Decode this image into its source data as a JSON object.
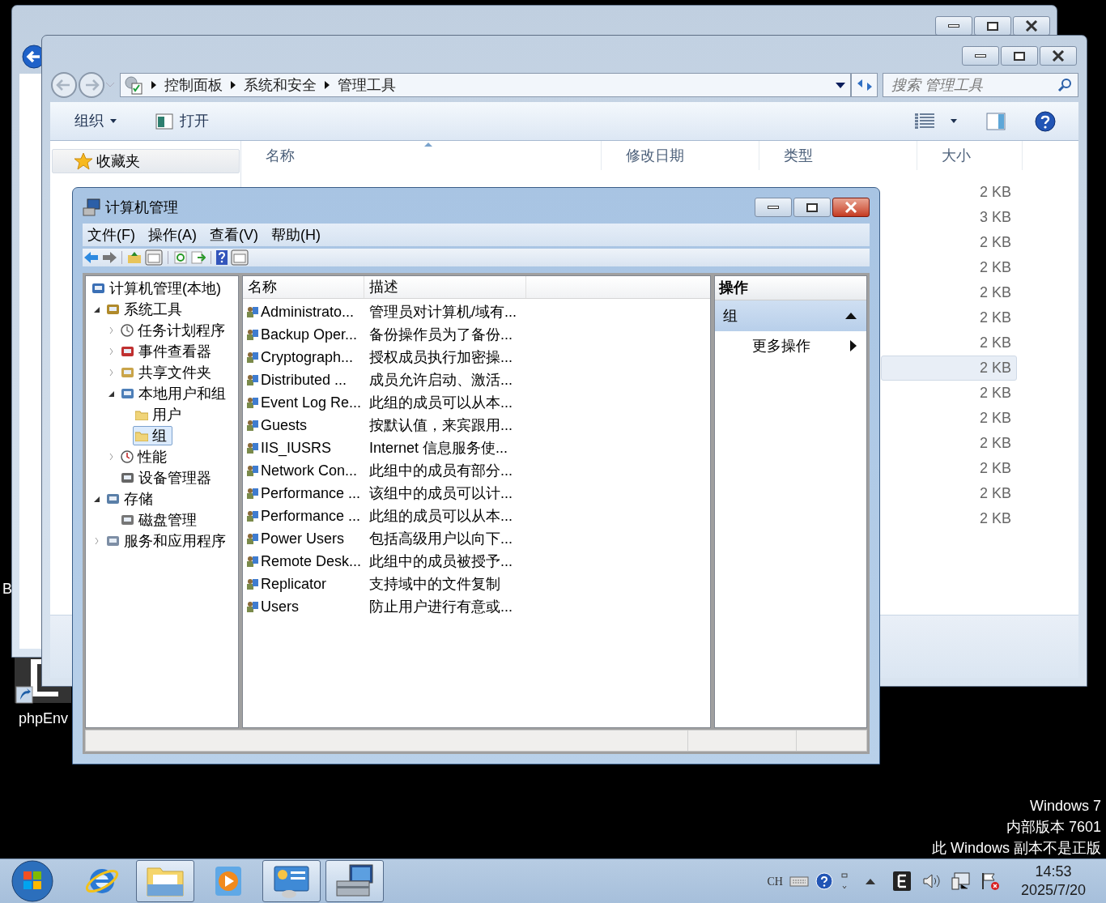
{
  "desktop": {
    "partial_label": "B",
    "icons": [
      {
        "label": "phpEnv"
      }
    ],
    "watermark": [
      "Windows 7",
      "内部版本 7601",
      "此 Windows 副本不是正版"
    ]
  },
  "explorer": {
    "breadcrumb": [
      "控制面板",
      "系统和安全",
      "管理工具"
    ],
    "search": {
      "placeholder": "搜索 管理工具"
    },
    "toolbar": [
      "组织",
      "打开"
    ],
    "nav": {
      "favorites": "收藏夹"
    },
    "columns": [
      "名称",
      "修改日期",
      "类型",
      "大小"
    ],
    "rows": [
      {
        "size": "2 KB",
        "selected": false
      },
      {
        "size": "3 KB",
        "selected": false
      },
      {
        "size": "2 KB",
        "selected": false
      },
      {
        "size": "2 KB",
        "selected": false
      },
      {
        "size": "2 KB",
        "selected": false
      },
      {
        "size": "2 KB",
        "selected": false
      },
      {
        "size": "2 KB",
        "selected": false
      },
      {
        "size": "2 KB",
        "selected": true
      },
      {
        "size": "2 KB",
        "selected": false
      },
      {
        "size": "2 KB",
        "selected": false
      },
      {
        "size": "2 KB",
        "selected": false
      },
      {
        "size": "2 KB",
        "selected": false
      },
      {
        "size": "2 KB",
        "selected": false
      },
      {
        "size": "2 KB",
        "selected": false
      }
    ]
  },
  "mmc": {
    "title": "计算机管理",
    "menu": [
      "文件(F)",
      "操作(A)",
      "查看(V)",
      "帮助(H)"
    ],
    "tree": [
      {
        "label": "计算机管理(本地)",
        "kind": "computer",
        "selected": false,
        "children": [
          {
            "label": "系统工具",
            "kind": "tools",
            "expanded": true,
            "selected": false,
            "children": [
              {
                "label": "任务计划程序",
                "kind": "clock",
                "expanded": false,
                "selected": false
              },
              {
                "label": "事件查看器",
                "kind": "event",
                "expanded": false,
                "selected": false
              },
              {
                "label": "共享文件夹",
                "kind": "share",
                "expanded": false,
                "selected": false
              },
              {
                "label": "本地用户和组",
                "kind": "users",
                "expanded": true,
                "selected": false,
                "children": [
                  {
                    "label": "用户",
                    "kind": "folder",
                    "selected": false
                  },
                  {
                    "label": "组",
                    "kind": "folder",
                    "selected": true
                  }
                ]
              },
              {
                "label": "性能",
                "kind": "perf",
                "expanded": false,
                "selected": false
              },
              {
                "label": "设备管理器",
                "kind": "device",
                "selected": false
              }
            ]
          },
          {
            "label": "存储",
            "kind": "storage",
            "expanded": true,
            "selected": false,
            "children": [
              {
                "label": "磁盘管理",
                "kind": "disk",
                "selected": false
              }
            ]
          },
          {
            "label": "服务和应用程序",
            "kind": "services",
            "expanded": false,
            "selected": false
          }
        ]
      }
    ],
    "columns": [
      "名称",
      "描述"
    ],
    "rows": [
      {
        "name": "Administrato...",
        "description": "管理员对计算机/域有..."
      },
      {
        "name": "Backup Oper...",
        "description": "备份操作员为了备份..."
      },
      {
        "name": "Cryptograph...",
        "description": "授权成员执行加密操..."
      },
      {
        "name": "Distributed ...",
        "description": "成员允许启动、激活..."
      },
      {
        "name": "Event Log Re...",
        "description": "此组的成员可以从本..."
      },
      {
        "name": "Guests",
        "description": "按默认值，来宾跟用..."
      },
      {
        "name": "IIS_IUSRS",
        "description": "Internet 信息服务使..."
      },
      {
        "name": "Network Con...",
        "description": "此组中的成员有部分..."
      },
      {
        "name": "Performance ...",
        "description": "该组中的成员可以计..."
      },
      {
        "name": "Performance ...",
        "description": "此组的成员可以从本..."
      },
      {
        "name": "Power Users",
        "description": "包括高级用户以向下..."
      },
      {
        "name": "Remote Desk...",
        "description": "此组中的成员被授予..."
      },
      {
        "name": "Replicator",
        "description": "支持域中的文件复制"
      },
      {
        "name": "Users",
        "description": "防止用户进行有意或..."
      }
    ],
    "actions": {
      "title": "操作",
      "section": "组",
      "items": [
        "更多操作"
      ]
    }
  },
  "taskbar": {
    "apps": [
      {
        "kind": "ie",
        "active": false
      },
      {
        "kind": "explorer",
        "active": true
      },
      {
        "kind": "media",
        "active": false
      },
      {
        "kind": "panel",
        "active": true
      },
      {
        "kind": "mmc",
        "active": true
      }
    ],
    "tray": {
      "language": "CH",
      "time": "14:53",
      "date": "2025/7/20"
    }
  }
}
